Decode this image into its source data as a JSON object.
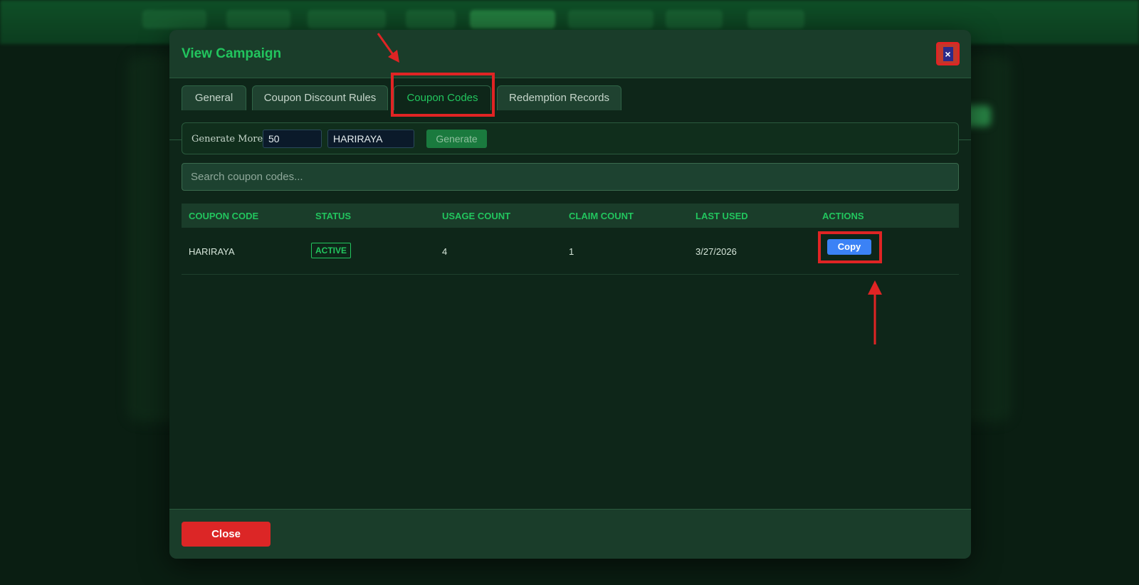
{
  "modal": {
    "title": "View Campaign",
    "close_icon": "×"
  },
  "tabs": [
    {
      "label": "General",
      "active": false
    },
    {
      "label": "Coupon Discount Rules",
      "active": false
    },
    {
      "label": "Coupon Codes",
      "active": true
    },
    {
      "label": "Redemption Records",
      "active": false
    }
  ],
  "generate": {
    "label": "Generate More:",
    "quantity": "50",
    "prefix": "HARIRAYA",
    "button": "Generate"
  },
  "search": {
    "placeholder": "Search coupon codes..."
  },
  "table": {
    "headers": [
      "COUPON CODE",
      "STATUS",
      "USAGE COUNT",
      "CLAIM COUNT",
      "LAST USED",
      "ACTIONS"
    ],
    "rows": [
      {
        "code": "HARIRAYA",
        "status": "ACTIVE",
        "usage": "4",
        "claim": "1",
        "last_used": "3/27/2026",
        "action": "Copy"
      }
    ]
  },
  "footer": {
    "close": "Close"
  },
  "colors": {
    "accent": "#22c55e",
    "annotation": "#e02424",
    "copy": "#3b82f6",
    "danger": "#dc2626"
  }
}
